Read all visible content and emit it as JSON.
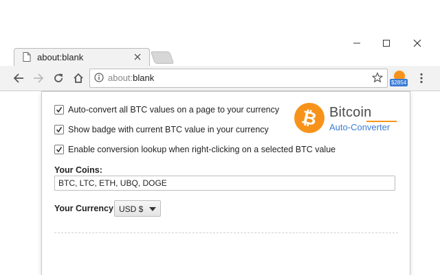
{
  "window": {
    "controls": {
      "minimize_icon": "minimize-icon",
      "maximize_icon": "maximize-icon",
      "close_icon": "close-icon"
    }
  },
  "tab": {
    "title": "about:blank",
    "favicon": "page-icon",
    "close_icon": "close-icon"
  },
  "toolbar": {
    "back_icon": "arrow-left-icon",
    "forward_icon": "arrow-right-icon",
    "reload_icon": "reload-icon",
    "home_icon": "home-icon",
    "url_prefix": "about:",
    "url_main": "blank",
    "star_icon": "star-icon",
    "extension_badge": "$2854",
    "menu_icon": "kebab-menu-icon"
  },
  "popup": {
    "options": [
      {
        "label": "Auto-convert all BTC values on a page to your currency",
        "checked": true
      },
      {
        "label": "Show badge with current BTC value in your currency",
        "checked": true
      },
      {
        "label": "Enable conversion lookup when right-clicking on a selected BTC value",
        "checked": true
      }
    ],
    "logo": {
      "coin_symbol": "₿",
      "title": "Bitcoin",
      "subtitle": "Auto-Converter"
    },
    "coins": {
      "label": "Your Coins:",
      "value": "BTC, LTC, ETH, UBQ, DOGE"
    },
    "currency": {
      "label": "Your Currency:",
      "selected": "USD $"
    }
  },
  "colors": {
    "bitcoin_orange": "#f7931a",
    "accent_blue": "#3a7bd5",
    "chrome_toolbar": "#f2f2f2"
  }
}
